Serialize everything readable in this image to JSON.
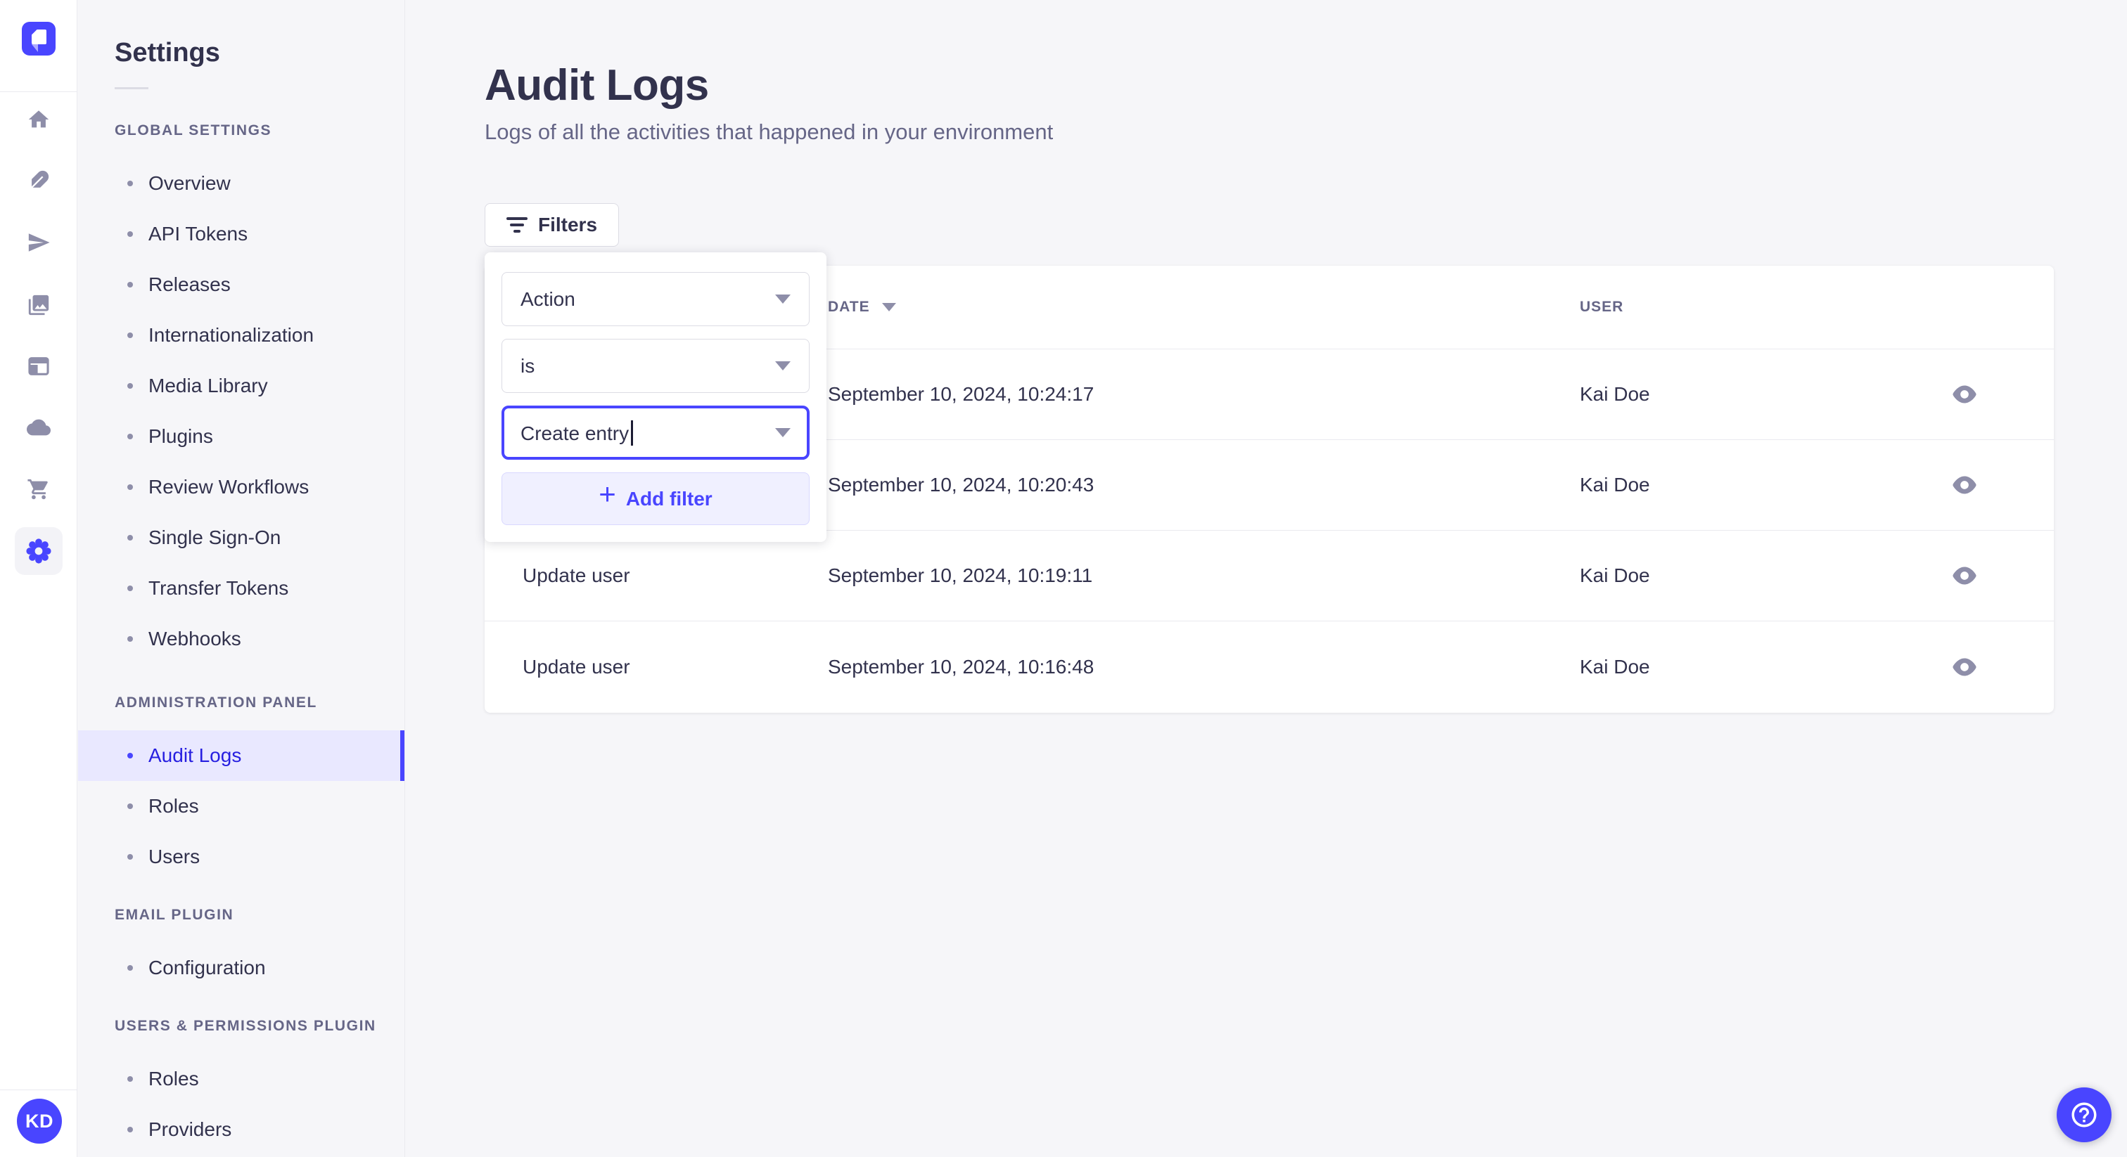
{
  "colors": {
    "primary": "#4945ff",
    "primary_text_active": "#271fe0",
    "primary_light_bg": "#f0f0ff",
    "active_item_bg": "#e9e8ff",
    "text_dark": "#32324d",
    "text_muted": "#666687",
    "icon_gray": "#8e8ea9",
    "page_bg": "#f6f6f9",
    "border": "#eaeaef",
    "input_border": "#dcdce4"
  },
  "rail": {
    "logo_icon": "strapi-logo",
    "icons": [
      "home-icon",
      "feather-icon",
      "paper-plane-icon",
      "media-library-icon",
      "layout-icon",
      "cloud-icon",
      "cart-icon",
      "settings-gear-icon"
    ],
    "active_icon": "settings-gear-icon",
    "avatar_initials": "KD"
  },
  "sidebar": {
    "title": "Settings",
    "active_item": "Audit Logs",
    "sections": [
      {
        "label": "GLOBAL SETTINGS",
        "items": [
          "Overview",
          "API Tokens",
          "Releases",
          "Internationalization",
          "Media Library",
          "Plugins",
          "Review Workflows",
          "Single Sign-On",
          "Transfer Tokens",
          "Webhooks"
        ]
      },
      {
        "label": "ADMINISTRATION PANEL",
        "items": [
          "Audit Logs",
          "Roles",
          "Users"
        ]
      },
      {
        "label": "EMAIL PLUGIN",
        "items": [
          "Configuration"
        ]
      },
      {
        "label": "USERS & PERMISSIONS PLUGIN",
        "items": [
          "Roles",
          "Providers"
        ]
      }
    ]
  },
  "main": {
    "title": "Audit Logs",
    "subtitle": "Logs of all the activities that happened in your environment",
    "filters_button_label": "Filters",
    "filter_popup": {
      "field_value": "Action",
      "operator_value": "is",
      "value_value": "Create entry",
      "add_filter_label": "Add filter"
    },
    "table": {
      "headers": {
        "action": "",
        "date": "DATE",
        "user": "USER"
      },
      "sort_column": "date",
      "rows": [
        {
          "action": "",
          "date": "September 10, 2024, 10:24:17",
          "user": "Kai Doe"
        },
        {
          "action": "",
          "date": "September 10, 2024, 10:20:43",
          "user": "Kai Doe"
        },
        {
          "action": "Update user",
          "date": "September 10, 2024, 10:19:11",
          "user": "Kai Doe"
        },
        {
          "action": "Update user",
          "date": "September 10, 2024, 10:16:48",
          "user": "Kai Doe"
        }
      ]
    }
  }
}
